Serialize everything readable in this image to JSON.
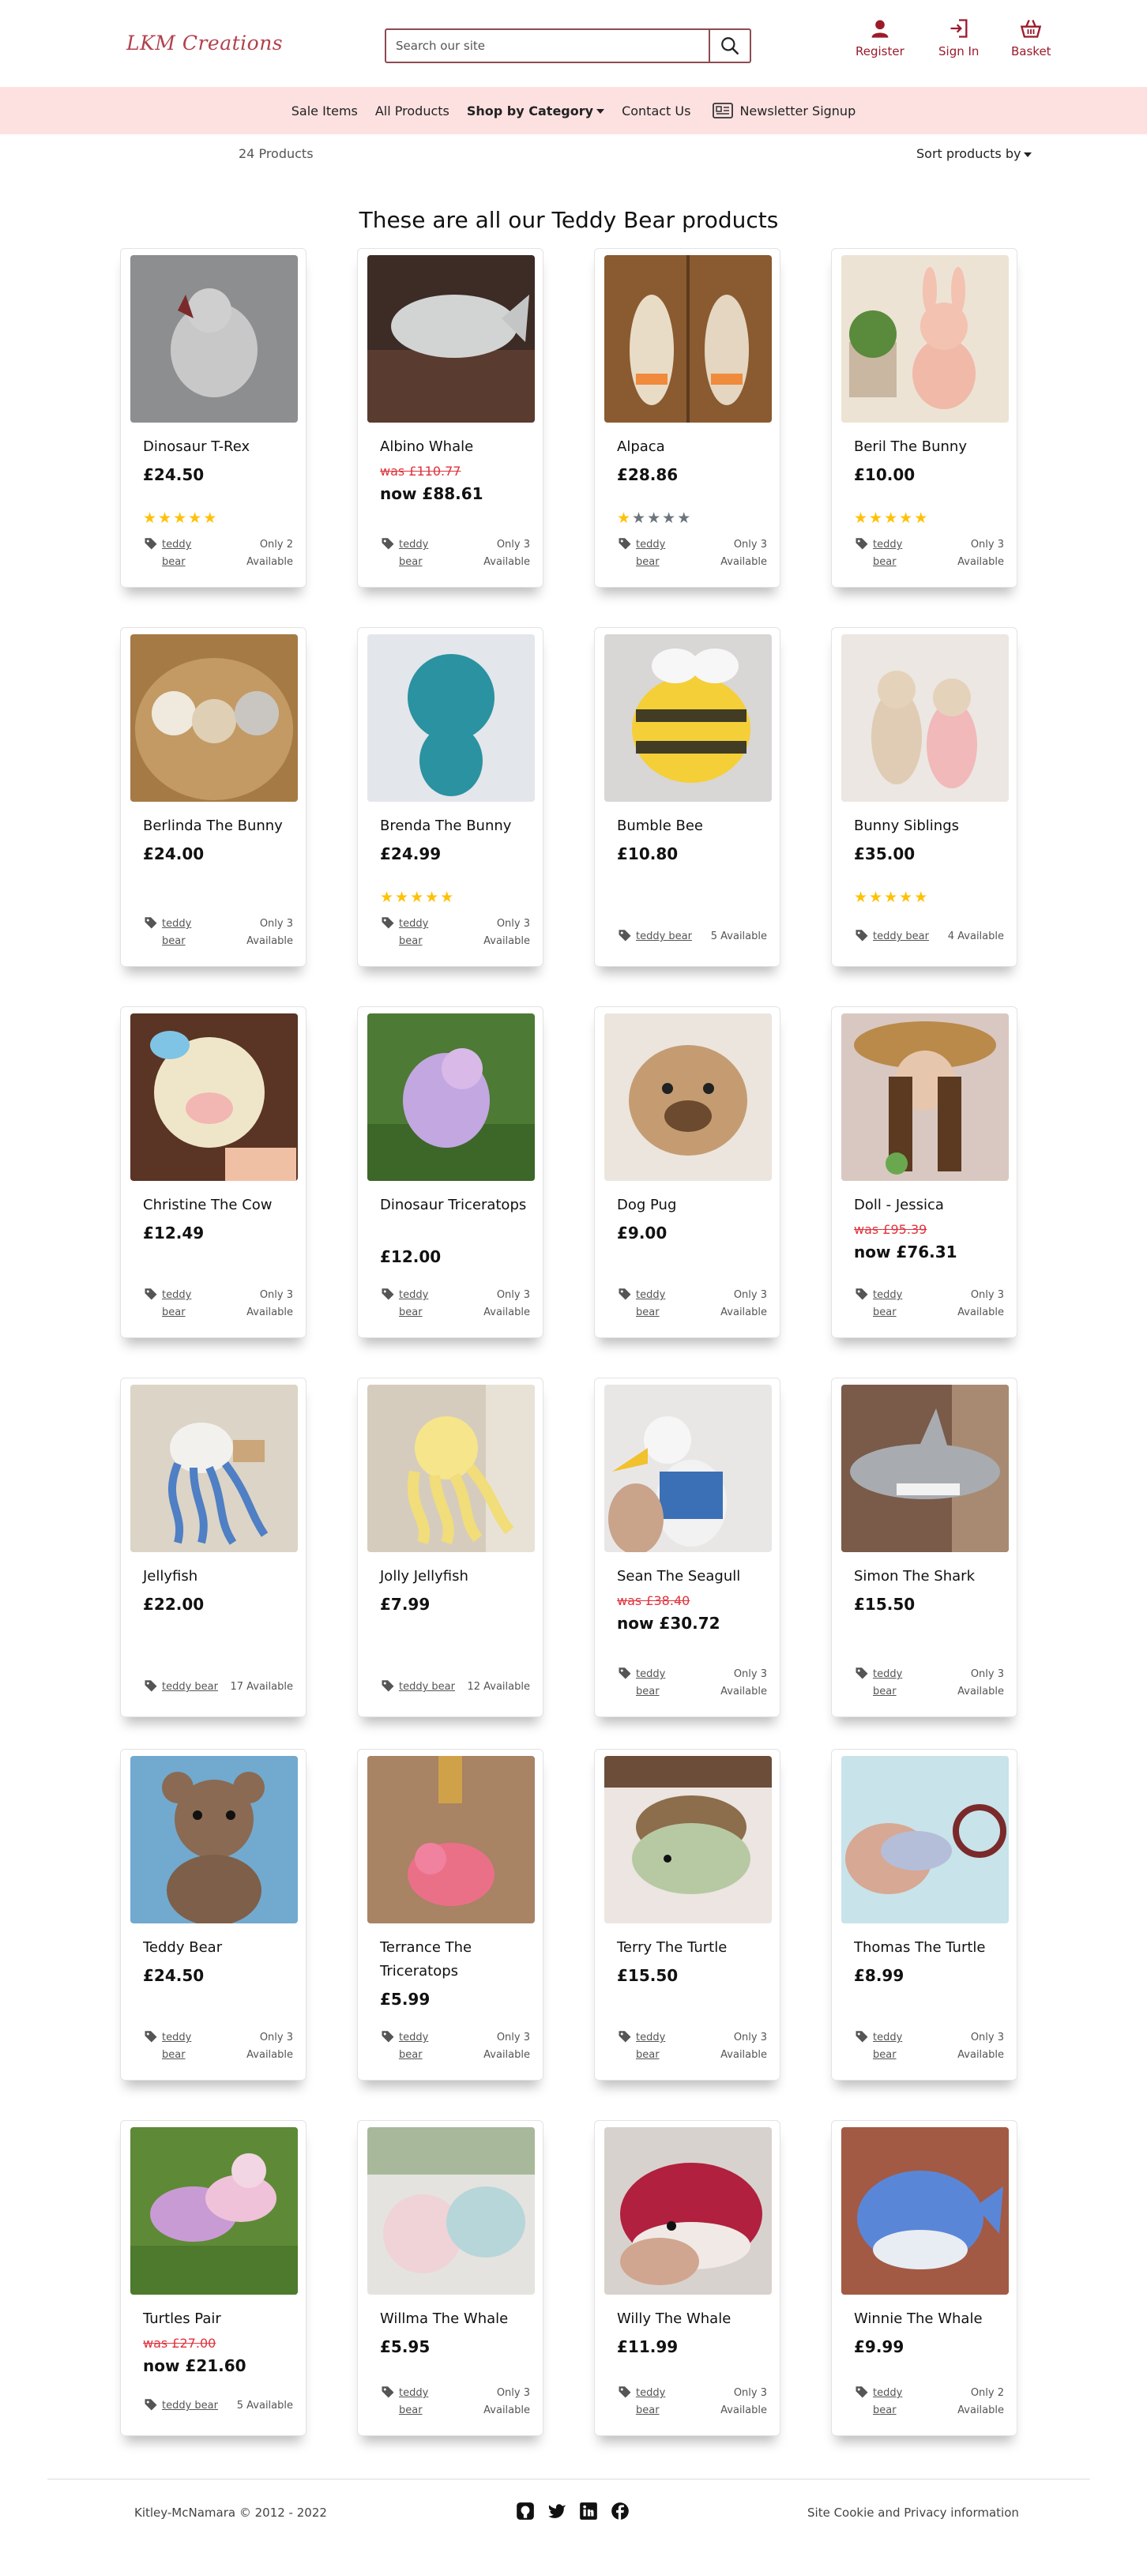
{
  "header": {
    "logo": "LKM Creations",
    "search_placeholder": "Search our site",
    "register": "Register",
    "sign_in": "Sign In",
    "basket": "Basket"
  },
  "nav": {
    "sale": "Sale Items",
    "all": "All Products",
    "category": "Shop by Category",
    "contact": "Contact Us",
    "newsletter": "Newsletter Signup"
  },
  "toolbar": {
    "count": "24 Products",
    "sort": "Sort products by"
  },
  "page_title": "These are all our Teddy Bear products",
  "products": [
    {
      "name": "Dinosaur T-Rex",
      "price": "£24.50",
      "rating": 5,
      "tag": "teddy bear",
      "avail": "Only 2 Available",
      "img": "gray"
    },
    {
      "name": "Albino Whale",
      "was": "was £110.77",
      "now": "now £88.61",
      "rating": 0,
      "tag": "teddy bear",
      "avail": "Only 3 Available",
      "img": "whale"
    },
    {
      "name": "Alpaca",
      "price": "£28.86",
      "rating": 1,
      "tag": "teddy bear",
      "avail": "Only 3 Available",
      "img": "wood"
    },
    {
      "name": "Beril The Bunny",
      "price": "£10.00",
      "rating": 5,
      "tag": "teddy bear",
      "avail": "Only 3 Available",
      "img": "pink"
    },
    {
      "name": "Berlinda The Bunny",
      "price": "£24.00",
      "rating": 0,
      "tag": "teddy bear",
      "avail": "Only 3 Available",
      "img": "basket"
    },
    {
      "name": "Brenda The Bunny",
      "price": "£24.99",
      "rating": 5,
      "tag": "teddy bear",
      "avail": "Only 3 Available",
      "img": "teal"
    },
    {
      "name": "Bumble Bee",
      "price": "£10.80",
      "rating": 0,
      "tag": "teddy bear",
      "avail": "5 Available",
      "img": "bee"
    },
    {
      "name": "Bunny Siblings",
      "price": "£35.00",
      "rating": 5,
      "tag": "teddy bear",
      "avail": "4 Available",
      "img": "siblings"
    },
    {
      "name": "Christine The Cow",
      "price": "£12.49",
      "rating": 0,
      "tag": "teddy bear",
      "avail": "Only 3 Available",
      "img": "cow"
    },
    {
      "name": "Dinosaur Triceratops",
      "price": "£12.00",
      "rating": 0,
      "tag": "teddy bear",
      "avail": "Only 3 Available",
      "img": "grass"
    },
    {
      "name": "Dog Pug",
      "price": "£9.00",
      "rating": 0,
      "tag": "teddy bear",
      "avail": "Only 3 Available",
      "img": "pug"
    },
    {
      "name": "Doll - Jessica",
      "was": "was £95.39",
      "now": "now £76.31",
      "rating": 0,
      "tag": "teddy bear",
      "avail": "Only 3 Available",
      "img": "doll"
    },
    {
      "name": "Jellyfish",
      "price": "£22.00",
      "rating": 0,
      "tag": "teddy bear",
      "avail": "17 Available",
      "img": "jelly"
    },
    {
      "name": "Jolly Jellyfish",
      "price": "£7.99",
      "rating": 0,
      "tag": "teddy bear",
      "avail": "12 Available",
      "img": "yellow"
    },
    {
      "name": "Sean The Seagull",
      "was": "was £38.40",
      "now": "now £30.72",
      "rating": 0,
      "tag": "teddy bear",
      "avail": "Only 3 Available",
      "img": "gull"
    },
    {
      "name": "Simon The Shark",
      "price": "£15.50",
      "rating": 0,
      "tag": "teddy bear",
      "avail": "Only 3 Available",
      "img": "shark"
    },
    {
      "name": "Teddy Bear",
      "price": "£24.50",
      "rating": 0,
      "tag": "teddy bear",
      "avail": "Only 3 Available",
      "img": "bear"
    },
    {
      "name": "Terrance The Triceratops",
      "price": "£5.99",
      "rating": 0,
      "tag": "teddy bear",
      "avail": "Only 3 Available",
      "img": "bag"
    },
    {
      "name": "Terry The Turtle",
      "price": "£15.50",
      "rating": 0,
      "tag": "teddy bear",
      "avail": "Only 3 Available",
      "img": "turtle"
    },
    {
      "name": "Thomas The Turtle",
      "price": "£8.99",
      "rating": 0,
      "tag": "teddy bear",
      "avail": "Only 3 Available",
      "img": "keyring"
    },
    {
      "name": "Turtles Pair",
      "was": "was £27.00",
      "now": "now £21.60",
      "rating": 0,
      "tag": "teddy bear",
      "avail": "5 Available",
      "img": "turtles"
    },
    {
      "name": "Willma The Whale",
      "price": "£5.95",
      "rating": 0,
      "tag": "teddy bear",
      "avail": "Only 3 Available",
      "img": "whales"
    },
    {
      "name": "Willy The Whale",
      "price": "£11.99",
      "rating": 0,
      "tag": "teddy bear",
      "avail": "Only 3 Available",
      "img": "red"
    },
    {
      "name": "Winnie The Whale",
      "price": "£9.99",
      "rating": 0,
      "tag": "teddy bear",
      "avail": "Only 2 Available",
      "img": "blue"
    }
  ],
  "footer": {
    "copyright": "Kitley-McNamara © 2012 - 2022",
    "cookie": "Site Cookie and Privacy information",
    "social": [
      "github-icon",
      "twitter-icon",
      "linkedin-icon",
      "facebook-icon"
    ]
  }
}
